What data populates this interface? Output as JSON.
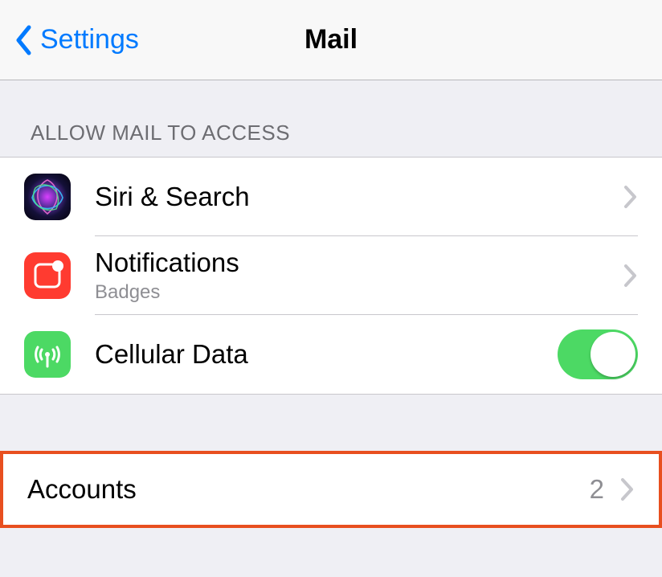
{
  "navbar": {
    "back_label": "Settings",
    "title": "Mail"
  },
  "section1": {
    "header": "ALLOW MAIL TO ACCESS",
    "rows": {
      "siri": {
        "title": "Siri & Search"
      },
      "notif": {
        "title": "Notifications",
        "subtitle": "Badges"
      },
      "cell": {
        "title": "Cellular Data",
        "toggle_on": true
      }
    }
  },
  "section2": {
    "accounts": {
      "title": "Accounts",
      "count": "2"
    }
  }
}
